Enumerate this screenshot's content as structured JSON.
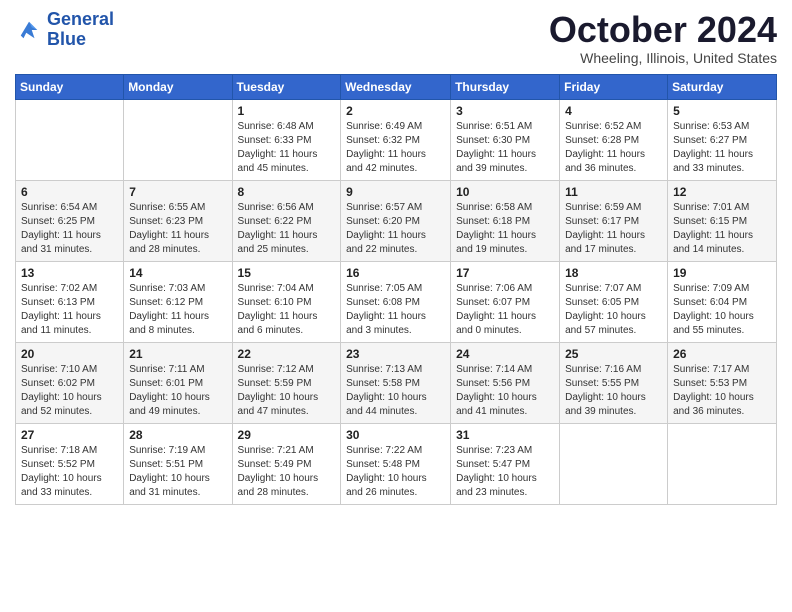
{
  "logo": {
    "line1": "General",
    "line2": "Blue"
  },
  "header": {
    "title": "October 2024",
    "location": "Wheeling, Illinois, United States"
  },
  "weekdays": [
    "Sunday",
    "Monday",
    "Tuesday",
    "Wednesday",
    "Thursday",
    "Friday",
    "Saturday"
  ],
  "weeks": [
    [
      {
        "day": "",
        "info": ""
      },
      {
        "day": "",
        "info": ""
      },
      {
        "day": "1",
        "info": "Sunrise: 6:48 AM\nSunset: 6:33 PM\nDaylight: 11 hours and 45 minutes."
      },
      {
        "day": "2",
        "info": "Sunrise: 6:49 AM\nSunset: 6:32 PM\nDaylight: 11 hours and 42 minutes."
      },
      {
        "day": "3",
        "info": "Sunrise: 6:51 AM\nSunset: 6:30 PM\nDaylight: 11 hours and 39 minutes."
      },
      {
        "day": "4",
        "info": "Sunrise: 6:52 AM\nSunset: 6:28 PM\nDaylight: 11 hours and 36 minutes."
      },
      {
        "day": "5",
        "info": "Sunrise: 6:53 AM\nSunset: 6:27 PM\nDaylight: 11 hours and 33 minutes."
      }
    ],
    [
      {
        "day": "6",
        "info": "Sunrise: 6:54 AM\nSunset: 6:25 PM\nDaylight: 11 hours and 31 minutes."
      },
      {
        "day": "7",
        "info": "Sunrise: 6:55 AM\nSunset: 6:23 PM\nDaylight: 11 hours and 28 minutes."
      },
      {
        "day": "8",
        "info": "Sunrise: 6:56 AM\nSunset: 6:22 PM\nDaylight: 11 hours and 25 minutes."
      },
      {
        "day": "9",
        "info": "Sunrise: 6:57 AM\nSunset: 6:20 PM\nDaylight: 11 hours and 22 minutes."
      },
      {
        "day": "10",
        "info": "Sunrise: 6:58 AM\nSunset: 6:18 PM\nDaylight: 11 hours and 19 minutes."
      },
      {
        "day": "11",
        "info": "Sunrise: 6:59 AM\nSunset: 6:17 PM\nDaylight: 11 hours and 17 minutes."
      },
      {
        "day": "12",
        "info": "Sunrise: 7:01 AM\nSunset: 6:15 PM\nDaylight: 11 hours and 14 minutes."
      }
    ],
    [
      {
        "day": "13",
        "info": "Sunrise: 7:02 AM\nSunset: 6:13 PM\nDaylight: 11 hours and 11 minutes."
      },
      {
        "day": "14",
        "info": "Sunrise: 7:03 AM\nSunset: 6:12 PM\nDaylight: 11 hours and 8 minutes."
      },
      {
        "day": "15",
        "info": "Sunrise: 7:04 AM\nSunset: 6:10 PM\nDaylight: 11 hours and 6 minutes."
      },
      {
        "day": "16",
        "info": "Sunrise: 7:05 AM\nSunset: 6:08 PM\nDaylight: 11 hours and 3 minutes."
      },
      {
        "day": "17",
        "info": "Sunrise: 7:06 AM\nSunset: 6:07 PM\nDaylight: 11 hours and 0 minutes."
      },
      {
        "day": "18",
        "info": "Sunrise: 7:07 AM\nSunset: 6:05 PM\nDaylight: 10 hours and 57 minutes."
      },
      {
        "day": "19",
        "info": "Sunrise: 7:09 AM\nSunset: 6:04 PM\nDaylight: 10 hours and 55 minutes."
      }
    ],
    [
      {
        "day": "20",
        "info": "Sunrise: 7:10 AM\nSunset: 6:02 PM\nDaylight: 10 hours and 52 minutes."
      },
      {
        "day": "21",
        "info": "Sunrise: 7:11 AM\nSunset: 6:01 PM\nDaylight: 10 hours and 49 minutes."
      },
      {
        "day": "22",
        "info": "Sunrise: 7:12 AM\nSunset: 5:59 PM\nDaylight: 10 hours and 47 minutes."
      },
      {
        "day": "23",
        "info": "Sunrise: 7:13 AM\nSunset: 5:58 PM\nDaylight: 10 hours and 44 minutes."
      },
      {
        "day": "24",
        "info": "Sunrise: 7:14 AM\nSunset: 5:56 PM\nDaylight: 10 hours and 41 minutes."
      },
      {
        "day": "25",
        "info": "Sunrise: 7:16 AM\nSunset: 5:55 PM\nDaylight: 10 hours and 39 minutes."
      },
      {
        "day": "26",
        "info": "Sunrise: 7:17 AM\nSunset: 5:53 PM\nDaylight: 10 hours and 36 minutes."
      }
    ],
    [
      {
        "day": "27",
        "info": "Sunrise: 7:18 AM\nSunset: 5:52 PM\nDaylight: 10 hours and 33 minutes."
      },
      {
        "day": "28",
        "info": "Sunrise: 7:19 AM\nSunset: 5:51 PM\nDaylight: 10 hours and 31 minutes."
      },
      {
        "day": "29",
        "info": "Sunrise: 7:21 AM\nSunset: 5:49 PM\nDaylight: 10 hours and 28 minutes."
      },
      {
        "day": "30",
        "info": "Sunrise: 7:22 AM\nSunset: 5:48 PM\nDaylight: 10 hours and 26 minutes."
      },
      {
        "day": "31",
        "info": "Sunrise: 7:23 AM\nSunset: 5:47 PM\nDaylight: 10 hours and 23 minutes."
      },
      {
        "day": "",
        "info": ""
      },
      {
        "day": "",
        "info": ""
      }
    ]
  ]
}
